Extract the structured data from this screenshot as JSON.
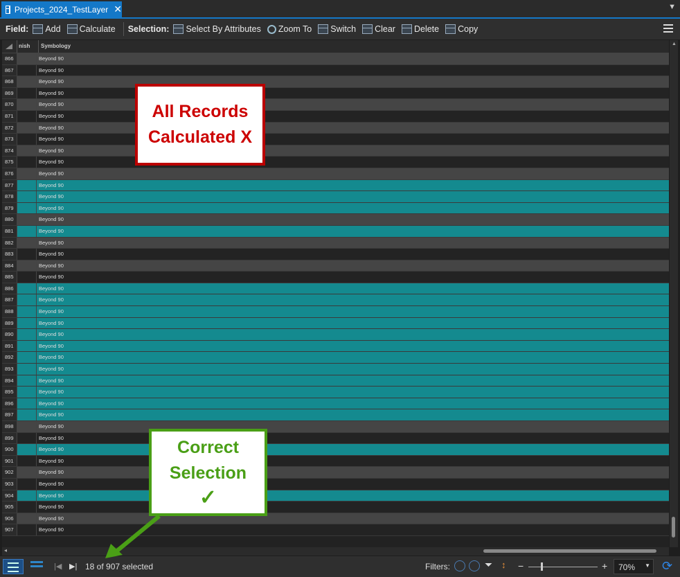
{
  "tab": {
    "title": "Projects_2024_TestLayer",
    "close": "✕"
  },
  "toolbar": {
    "field_label": "Field:",
    "add": "Add",
    "calculate": "Calculate",
    "selection_label": "Selection:",
    "select_by_attributes": "Select By Attributes",
    "zoom_to": "Zoom To",
    "switch": "Switch",
    "clear": "Clear",
    "delete": "Delete",
    "copy": "Copy"
  },
  "table": {
    "columns": [
      "nish",
      "Symbology"
    ],
    "rows": [
      {
        "id": "866",
        "value": "Beyond 90",
        "selected": false
      },
      {
        "id": "867",
        "value": "Beyond 90",
        "selected": false
      },
      {
        "id": "868",
        "value": "Beyond 90",
        "selected": false
      },
      {
        "id": "869",
        "value": "Beyond 90",
        "selected": false
      },
      {
        "id": "870",
        "value": "Beyond 90",
        "selected": false
      },
      {
        "id": "871",
        "value": "Beyond 90",
        "selected": false
      },
      {
        "id": "872",
        "value": "Beyond 90",
        "selected": false
      },
      {
        "id": "873",
        "value": "Beyond 90",
        "selected": false
      },
      {
        "id": "874",
        "value": "Beyond 90",
        "selected": false
      },
      {
        "id": "875",
        "value": "Beyond 90",
        "selected": false
      },
      {
        "id": "876",
        "value": "Beyond 90",
        "selected": false
      },
      {
        "id": "877",
        "value": "Beyond 90",
        "selected": true
      },
      {
        "id": "878",
        "value": "Beyond 90",
        "selected": true
      },
      {
        "id": "879",
        "value": "Beyond 90",
        "selected": true
      },
      {
        "id": "880",
        "value": "Beyond 90",
        "selected": false
      },
      {
        "id": "881",
        "value": "Beyond 90",
        "selected": true
      },
      {
        "id": "882",
        "value": "Beyond 90",
        "selected": false
      },
      {
        "id": "883",
        "value": "Beyond 90",
        "selected": false
      },
      {
        "id": "884",
        "value": "Beyond 90",
        "selected": false
      },
      {
        "id": "885",
        "value": "Beyond 90",
        "selected": false
      },
      {
        "id": "886",
        "value": "Beyond 90",
        "selected": true
      },
      {
        "id": "887",
        "value": "Beyond 90",
        "selected": true
      },
      {
        "id": "888",
        "value": "Beyond 90",
        "selected": true
      },
      {
        "id": "889",
        "value": "Beyond 90",
        "selected": true
      },
      {
        "id": "890",
        "value": "Beyond 90",
        "selected": true
      },
      {
        "id": "891",
        "value": "Beyond 90",
        "selected": true
      },
      {
        "id": "892",
        "value": "Beyond 90",
        "selected": true
      },
      {
        "id": "893",
        "value": "Beyond 90",
        "selected": true
      },
      {
        "id": "894",
        "value": "Beyond 90",
        "selected": true
      },
      {
        "id": "895",
        "value": "Beyond 90",
        "selected": true
      },
      {
        "id": "896",
        "value": "Beyond 90",
        "selected": true
      },
      {
        "id": "897",
        "value": "Beyond 90",
        "selected": true
      },
      {
        "id": "898",
        "value": "Beyond 90",
        "selected": false
      },
      {
        "id": "899",
        "value": "Beyond 90",
        "selected": false
      },
      {
        "id": "900",
        "value": "Beyond 90",
        "selected": true
      },
      {
        "id": "901",
        "value": "Beyond 90",
        "selected": false
      },
      {
        "id": "902",
        "value": "Beyond 90",
        "selected": false
      },
      {
        "id": "903",
        "value": "Beyond 90",
        "selected": false
      },
      {
        "id": "904",
        "value": "Beyond 90",
        "selected": true
      },
      {
        "id": "905",
        "value": "Beyond 90",
        "selected": false
      },
      {
        "id": "906",
        "value": "Beyond 90",
        "selected": false
      },
      {
        "id": "907",
        "value": "Beyond 90",
        "selected": false
      }
    ]
  },
  "status": {
    "selected_text": "18 of 907 selected",
    "filters_label": "Filters:",
    "zoom": "70%"
  },
  "callouts": {
    "red_line1": "All Records",
    "red_line2": "Calculated X",
    "green_line1": "Correct",
    "green_line2": "Selection",
    "green_mark": "✓"
  },
  "colors": {
    "accent": "#1478c8",
    "selected_row": "#148a8f",
    "red": "#c00000",
    "green": "#4a9f16"
  }
}
